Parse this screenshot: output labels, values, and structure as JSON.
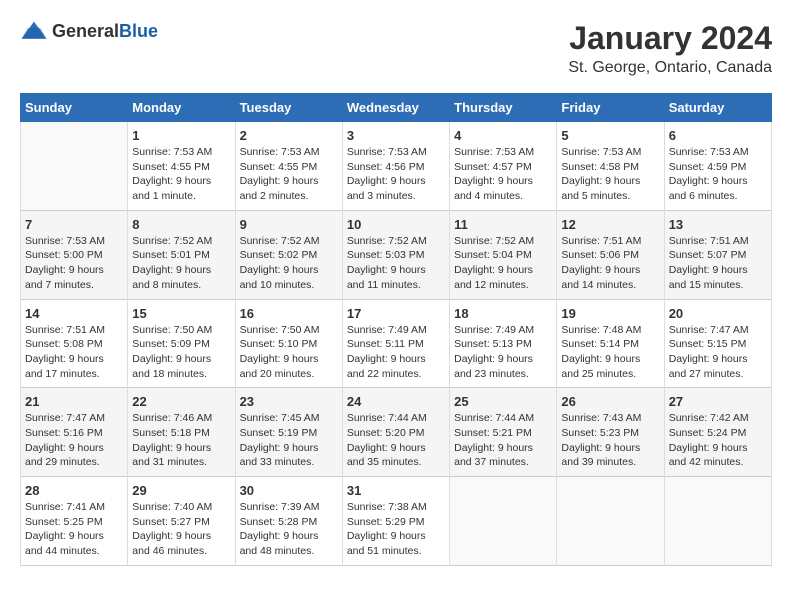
{
  "logo": {
    "text_general": "General",
    "text_blue": "Blue"
  },
  "title": "January 2024",
  "location": "St. George, Ontario, Canada",
  "days_of_week": [
    "Sunday",
    "Monday",
    "Tuesday",
    "Wednesday",
    "Thursday",
    "Friday",
    "Saturday"
  ],
  "weeks": [
    [
      {
        "day": "",
        "info": ""
      },
      {
        "day": "1",
        "info": "Sunrise: 7:53 AM\nSunset: 4:55 PM\nDaylight: 9 hours\nand 1 minute."
      },
      {
        "day": "2",
        "info": "Sunrise: 7:53 AM\nSunset: 4:55 PM\nDaylight: 9 hours\nand 2 minutes."
      },
      {
        "day": "3",
        "info": "Sunrise: 7:53 AM\nSunset: 4:56 PM\nDaylight: 9 hours\nand 3 minutes."
      },
      {
        "day": "4",
        "info": "Sunrise: 7:53 AM\nSunset: 4:57 PM\nDaylight: 9 hours\nand 4 minutes."
      },
      {
        "day": "5",
        "info": "Sunrise: 7:53 AM\nSunset: 4:58 PM\nDaylight: 9 hours\nand 5 minutes."
      },
      {
        "day": "6",
        "info": "Sunrise: 7:53 AM\nSunset: 4:59 PM\nDaylight: 9 hours\nand 6 minutes."
      }
    ],
    [
      {
        "day": "7",
        "info": "Sunrise: 7:53 AM\nSunset: 5:00 PM\nDaylight: 9 hours\nand 7 minutes."
      },
      {
        "day": "8",
        "info": "Sunrise: 7:52 AM\nSunset: 5:01 PM\nDaylight: 9 hours\nand 8 minutes."
      },
      {
        "day": "9",
        "info": "Sunrise: 7:52 AM\nSunset: 5:02 PM\nDaylight: 9 hours\nand 10 minutes."
      },
      {
        "day": "10",
        "info": "Sunrise: 7:52 AM\nSunset: 5:03 PM\nDaylight: 9 hours\nand 11 minutes."
      },
      {
        "day": "11",
        "info": "Sunrise: 7:52 AM\nSunset: 5:04 PM\nDaylight: 9 hours\nand 12 minutes."
      },
      {
        "day": "12",
        "info": "Sunrise: 7:51 AM\nSunset: 5:06 PM\nDaylight: 9 hours\nand 14 minutes."
      },
      {
        "day": "13",
        "info": "Sunrise: 7:51 AM\nSunset: 5:07 PM\nDaylight: 9 hours\nand 15 minutes."
      }
    ],
    [
      {
        "day": "14",
        "info": "Sunrise: 7:51 AM\nSunset: 5:08 PM\nDaylight: 9 hours\nand 17 minutes."
      },
      {
        "day": "15",
        "info": "Sunrise: 7:50 AM\nSunset: 5:09 PM\nDaylight: 9 hours\nand 18 minutes."
      },
      {
        "day": "16",
        "info": "Sunrise: 7:50 AM\nSunset: 5:10 PM\nDaylight: 9 hours\nand 20 minutes."
      },
      {
        "day": "17",
        "info": "Sunrise: 7:49 AM\nSunset: 5:11 PM\nDaylight: 9 hours\nand 22 minutes."
      },
      {
        "day": "18",
        "info": "Sunrise: 7:49 AM\nSunset: 5:13 PM\nDaylight: 9 hours\nand 23 minutes."
      },
      {
        "day": "19",
        "info": "Sunrise: 7:48 AM\nSunset: 5:14 PM\nDaylight: 9 hours\nand 25 minutes."
      },
      {
        "day": "20",
        "info": "Sunrise: 7:47 AM\nSunset: 5:15 PM\nDaylight: 9 hours\nand 27 minutes."
      }
    ],
    [
      {
        "day": "21",
        "info": "Sunrise: 7:47 AM\nSunset: 5:16 PM\nDaylight: 9 hours\nand 29 minutes."
      },
      {
        "day": "22",
        "info": "Sunrise: 7:46 AM\nSunset: 5:18 PM\nDaylight: 9 hours\nand 31 minutes."
      },
      {
        "day": "23",
        "info": "Sunrise: 7:45 AM\nSunset: 5:19 PM\nDaylight: 9 hours\nand 33 minutes."
      },
      {
        "day": "24",
        "info": "Sunrise: 7:44 AM\nSunset: 5:20 PM\nDaylight: 9 hours\nand 35 minutes."
      },
      {
        "day": "25",
        "info": "Sunrise: 7:44 AM\nSunset: 5:21 PM\nDaylight: 9 hours\nand 37 minutes."
      },
      {
        "day": "26",
        "info": "Sunrise: 7:43 AM\nSunset: 5:23 PM\nDaylight: 9 hours\nand 39 minutes."
      },
      {
        "day": "27",
        "info": "Sunrise: 7:42 AM\nSunset: 5:24 PM\nDaylight: 9 hours\nand 42 minutes."
      }
    ],
    [
      {
        "day": "28",
        "info": "Sunrise: 7:41 AM\nSunset: 5:25 PM\nDaylight: 9 hours\nand 44 minutes."
      },
      {
        "day": "29",
        "info": "Sunrise: 7:40 AM\nSunset: 5:27 PM\nDaylight: 9 hours\nand 46 minutes."
      },
      {
        "day": "30",
        "info": "Sunrise: 7:39 AM\nSunset: 5:28 PM\nDaylight: 9 hours\nand 48 minutes."
      },
      {
        "day": "31",
        "info": "Sunrise: 7:38 AM\nSunset: 5:29 PM\nDaylight: 9 hours\nand 51 minutes."
      },
      {
        "day": "",
        "info": ""
      },
      {
        "day": "",
        "info": ""
      },
      {
        "day": "",
        "info": ""
      }
    ]
  ]
}
